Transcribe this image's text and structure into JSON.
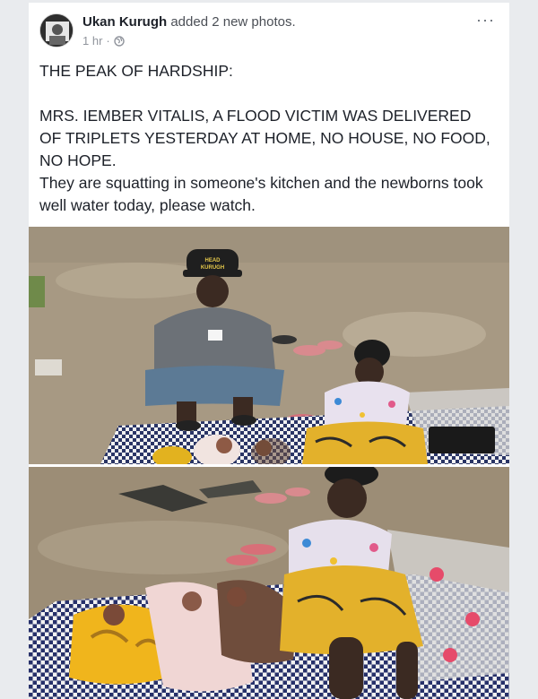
{
  "post": {
    "author": "Ukan Kurugh",
    "action": "added 2 new photos.",
    "time": "1 hr",
    "separator": "·",
    "privacy_icon": "globe-icon",
    "more_label": "···",
    "text": {
      "line1": "THE PEAK OF HARDSHIP:",
      "line2": "MRS. IEMBER VITALIS, A FLOOD VICTIM WAS DELIVERED OF TRIPLETS YESTERDAY AT HOME, NO HOUSE, NO FOOD, NO HOPE.",
      "line3": "They are squatting in someone's kitchen and the newborns took well water today, please watch."
    },
    "photo1": {
      "cap_text_1": "HEAD",
      "cap_text_2": "KURUGH"
    }
  },
  "colors": {
    "background": "#e9ebee",
    "card": "#ffffff",
    "text": "#1d2129",
    "meta": "#90949c"
  }
}
